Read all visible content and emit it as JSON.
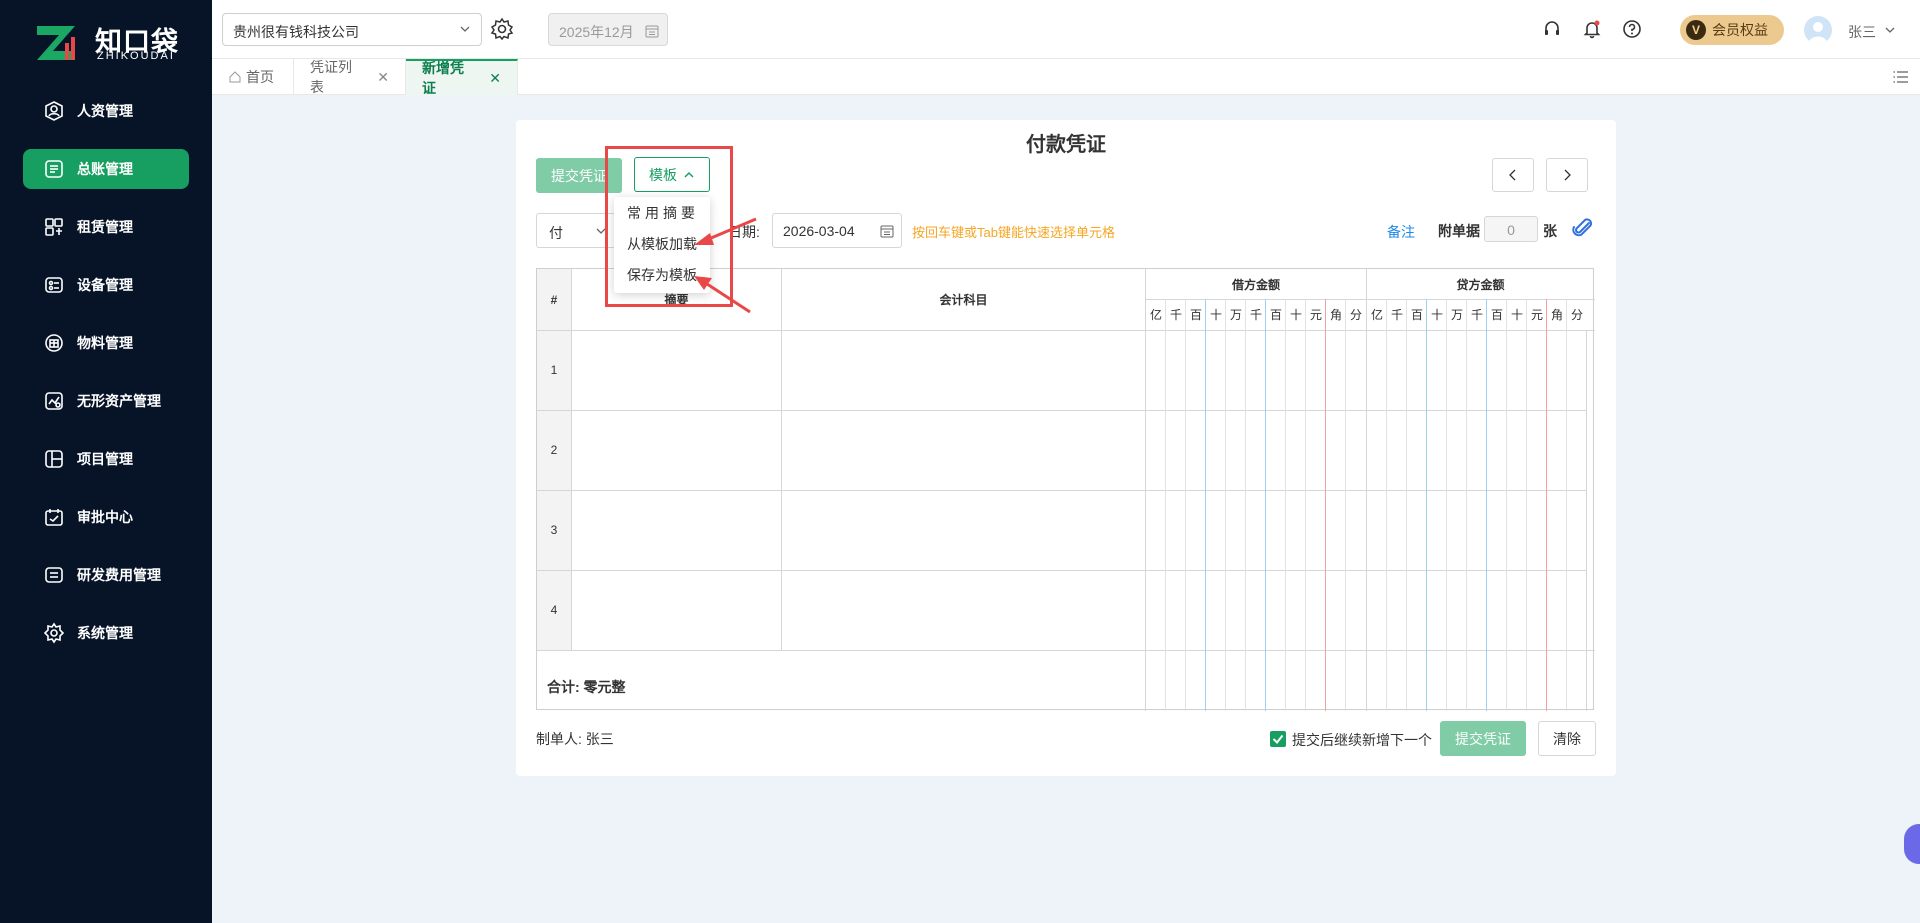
{
  "brand": {
    "name_cn": "知口袋",
    "name_en": "ZHIKOUDAI"
  },
  "sidebar": {
    "items": [
      {
        "label": "人资管理",
        "icon": "person-icon",
        "active": false
      },
      {
        "label": "总账管理",
        "icon": "ledger-icon",
        "active": true
      },
      {
        "label": "租赁管理",
        "icon": "lease-icon",
        "active": false
      },
      {
        "label": "设备管理",
        "icon": "device-icon",
        "active": false
      },
      {
        "label": "物料管理",
        "icon": "material-icon",
        "active": false
      },
      {
        "label": "无形资产管理",
        "icon": "intangible-asset-icon",
        "active": false
      },
      {
        "label": "项目管理",
        "icon": "project-icon",
        "active": false
      },
      {
        "label": "审批中心",
        "icon": "approval-icon",
        "active": false
      },
      {
        "label": "研发费用管理",
        "icon": "rd-expense-icon",
        "active": false
      },
      {
        "label": "系统管理",
        "icon": "settings-icon",
        "active": false
      }
    ]
  },
  "header": {
    "company": "贵州很有钱科技公司",
    "period": "2025年12月",
    "vip_label": "会员权益",
    "vip_badge": "V",
    "username": "张三"
  },
  "tabs": [
    {
      "label": "首页",
      "closable": false,
      "active": false
    },
    {
      "label": "凭证列表",
      "closable": true,
      "active": false
    },
    {
      "label": "新增凭证",
      "closable": true,
      "active": true
    }
  ],
  "voucher": {
    "title": "付款凭证",
    "submit_label": "提交凭证",
    "template_label": "模板",
    "template_menu": [
      "常用摘要",
      "从模板加载",
      "保存为模板"
    ],
    "type_value": "付",
    "date_label": "日期:",
    "date_value": "2026-03-04",
    "hint": "按回车键或Tab键能快速选择单元格",
    "note_label": "备注",
    "attach_label": "附单据",
    "attach_count": "0",
    "attach_unit": "张",
    "col_index": "#",
    "col_summary": "摘要",
    "col_account": "会计科目",
    "col_debit": "借方金额",
    "col_credit": "贷方金额",
    "digits": [
      "亿",
      "千",
      "百",
      "十",
      "万",
      "千",
      "百",
      "十",
      "元",
      "角",
      "分"
    ],
    "rows": [
      "1",
      "2",
      "3",
      "4"
    ],
    "total_label": "合计:  零元整",
    "maker_label": "制单人:  张三",
    "continue_label": "提交后继续新增下一个",
    "continue_checked": true,
    "clear_label": "清除"
  },
  "colors": {
    "accent": "#179f61",
    "sidebar_bg": "#071428",
    "annotation": "#e84848",
    "hint": "#f5a623"
  }
}
